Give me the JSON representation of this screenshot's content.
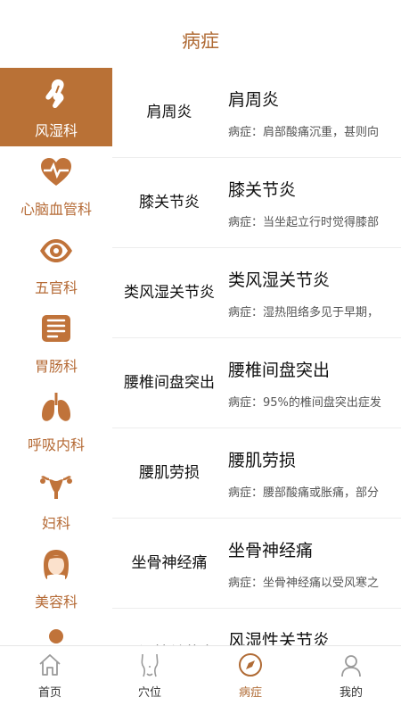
{
  "header": {
    "title": "病症"
  },
  "sidebar": {
    "items": [
      {
        "label": "风湿科",
        "icon": "joint-icon",
        "active": true
      },
      {
        "label": "心脑血管科",
        "icon": "heart-pulse-icon",
        "active": false
      },
      {
        "label": "五官科",
        "icon": "eye-icon",
        "active": false
      },
      {
        "label": "胃肠科",
        "icon": "intestine-icon",
        "active": false
      },
      {
        "label": "呼吸内科",
        "icon": "lungs-icon",
        "active": false
      },
      {
        "label": "妇科",
        "icon": "uterus-icon",
        "active": false
      },
      {
        "label": "美容科",
        "icon": "woman-face-icon",
        "active": false
      },
      {
        "label": "",
        "icon": "person-icon",
        "active": false
      }
    ]
  },
  "list": {
    "rows": [
      {
        "name": "肩周炎",
        "title": "肩周炎",
        "desc": "病症：肩部酸痛沉重，甚则向"
      },
      {
        "name": "膝关节炎",
        "title": "膝关节炎",
        "desc": "病症：当坐起立行时觉得膝部"
      },
      {
        "name": "类风湿关节炎",
        "title": "类风湿关节炎",
        "desc": "病症：湿热阻络多见于早期，"
      },
      {
        "name": "腰椎间盘突出",
        "title": "腰椎间盘突出",
        "desc": "病症：95%的椎间盘突出症发"
      },
      {
        "name": "腰肌劳损",
        "title": "腰肌劳损",
        "desc": "病症：腰部酸痛或胀痛，部分"
      },
      {
        "name": "坐骨神经痛",
        "title": "坐骨神经痛",
        "desc": "病症：坐骨神经痛以受风寒之"
      },
      {
        "name": "风湿性关节炎",
        "title": "风湿性关节炎",
        "desc": ""
      }
    ]
  },
  "tabbar": {
    "tabs": [
      {
        "label": "首页",
        "icon": "home-icon"
      },
      {
        "label": "穴位",
        "icon": "body-outline-icon"
      },
      {
        "label": "病症",
        "icon": "compass-icon",
        "active": true
      },
      {
        "label": "我的",
        "icon": "user-icon"
      }
    ]
  },
  "colors": {
    "accent": "#b97136",
    "accent_text": "#b06b35",
    "inactive_icon": "#9a9a9a"
  }
}
